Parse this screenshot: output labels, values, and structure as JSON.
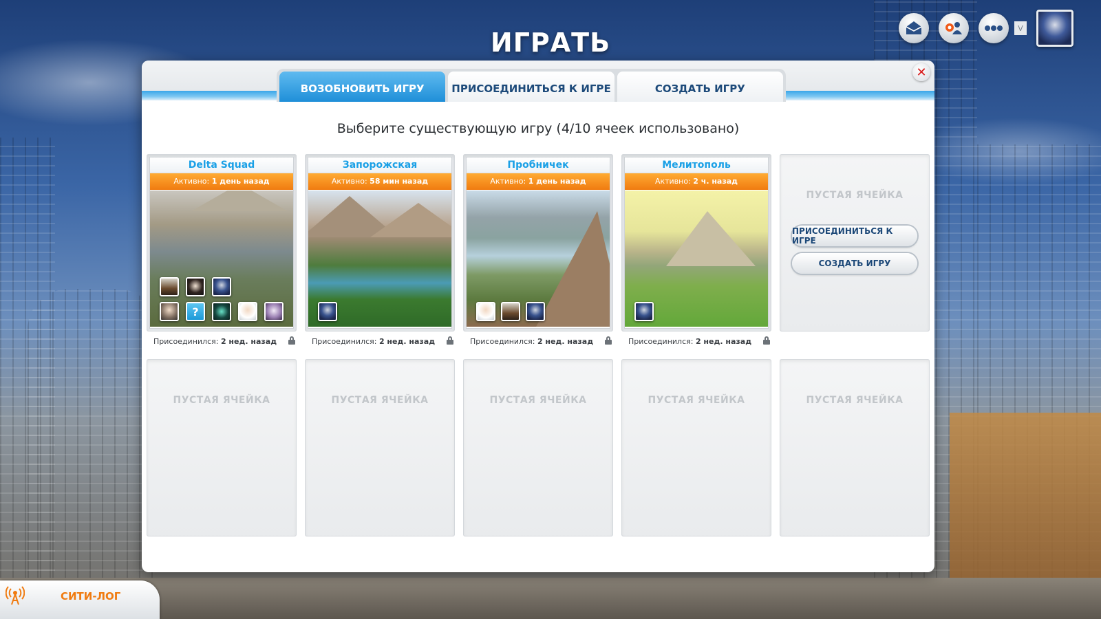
{
  "page": {
    "title": "ИГРАТЬ"
  },
  "top_bar": {
    "icons": [
      "mail-icon",
      "friends-icon",
      "more-icon",
      "dropdown-icon",
      "avatar"
    ],
    "dropdown_glyph": "V"
  },
  "tabs": [
    {
      "label": "ВОЗОБНОВИТЬ ИГРУ",
      "active": true
    },
    {
      "label": "ПРИСОЕДИНИТЬСЯ К ИГРЕ",
      "active": false
    },
    {
      "label": "СОЗДАТЬ ИГРУ",
      "active": false
    }
  ],
  "close_glyph": "✕",
  "subtitle": "Выберите существующую игру (4/10 ячеек использовано)",
  "games": [
    {
      "name": "Delta Squad",
      "active_prefix": "Активно:",
      "active_time": "1 день назад",
      "joined_prefix": "Присоединился:",
      "joined_time": "2 нед. назад",
      "avatars": [
        "rider",
        "girl",
        "robot",
        "man",
        "unknown",
        "alien",
        "person",
        "purple"
      ]
    },
    {
      "name": "Запорожская",
      "active_prefix": "Активно:",
      "active_time": "58 мин назад",
      "joined_prefix": "Присоединился:",
      "joined_time": "2 нед. назад",
      "avatars": [
        "robot"
      ]
    },
    {
      "name": "Пробничек",
      "active_prefix": "Активно:",
      "active_time": "1 день назад",
      "joined_prefix": "Присоединился:",
      "joined_time": "2 нед. назад",
      "avatars": [
        "person",
        "rider",
        "robot"
      ]
    },
    {
      "name": "Мелитополь",
      "active_prefix": "Активно:",
      "active_time": "2 ч. назад",
      "joined_prefix": "Присоединился:",
      "joined_time": "2 нед. назад",
      "avatars": [
        "robot"
      ]
    }
  ],
  "empty_slot": {
    "label": "ПУСТАЯ ЯЧЕЙКА",
    "join_button": "ПРИСОЕДИНИТЬСЯ К ИГРЕ",
    "create_button": "СОЗДАТЬ ИГРУ"
  },
  "citylog": {
    "label": "СИТИ-ЛОГ"
  },
  "colors": {
    "accent_blue": "#1aa0e6",
    "status_orange": "#f07b10",
    "close_red": "#d81b1b"
  }
}
